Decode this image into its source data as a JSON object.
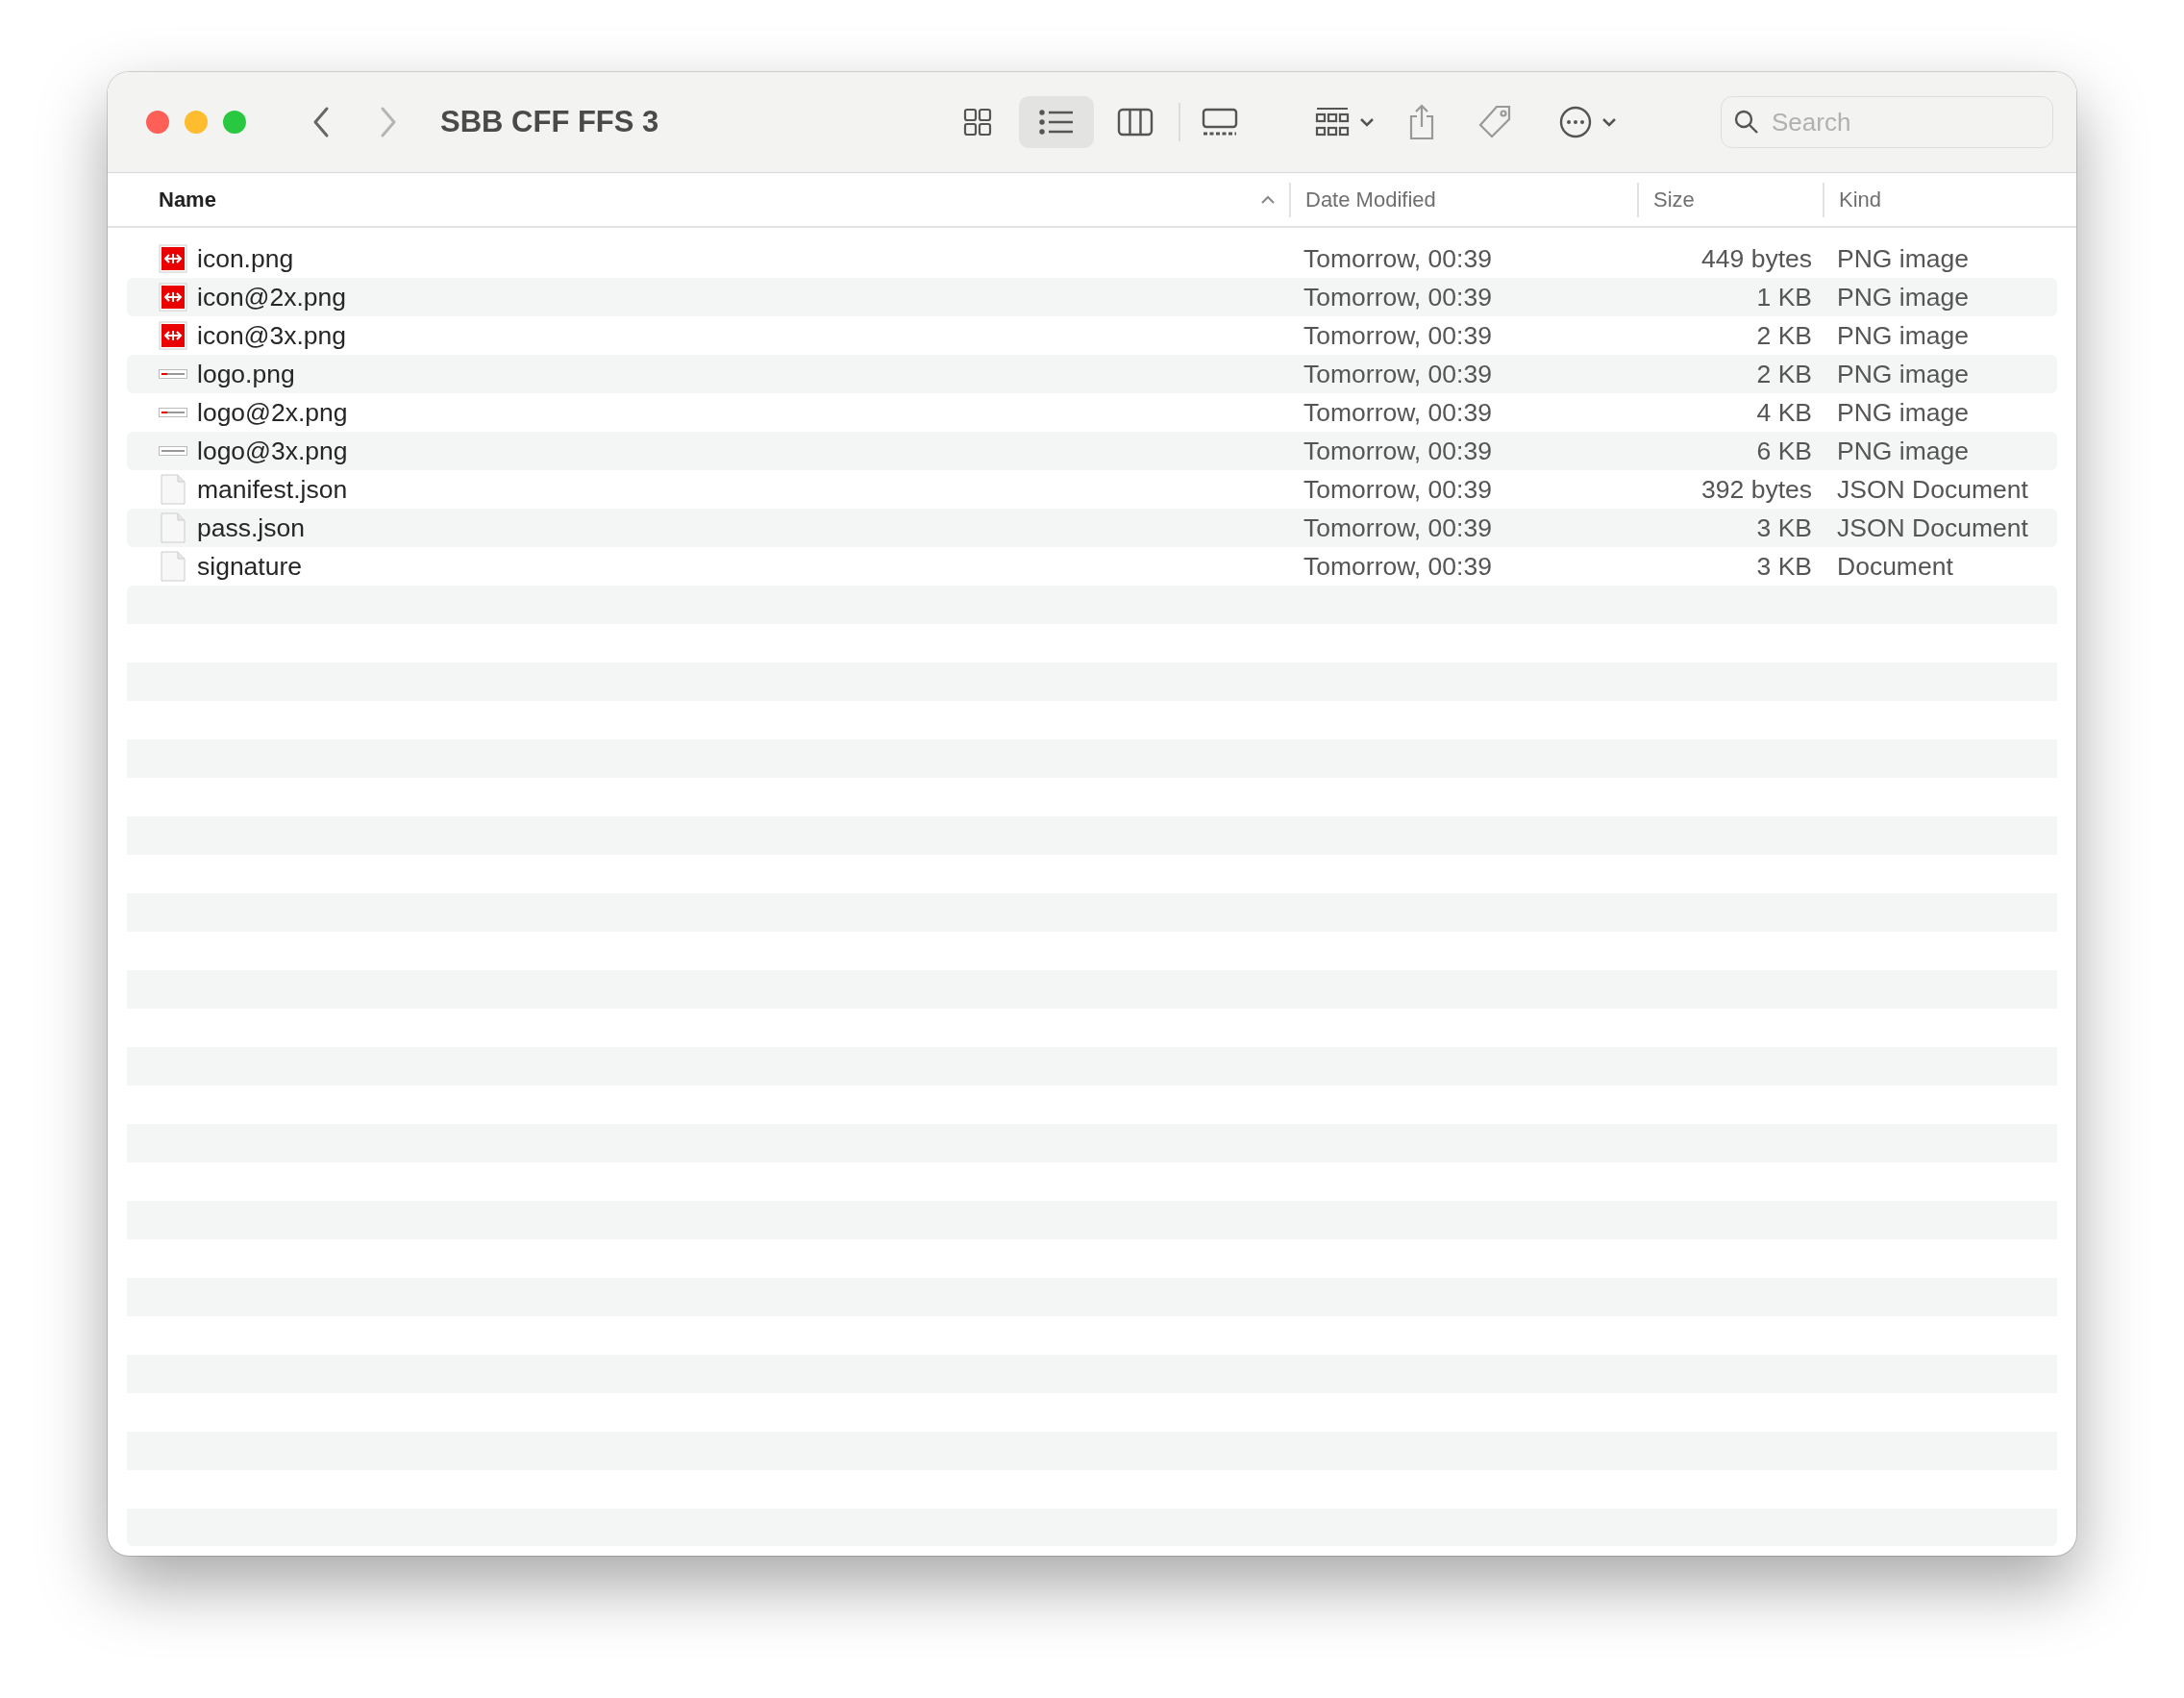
{
  "window": {
    "title": "SBB CFF FFS 3"
  },
  "navigation": {
    "back": {
      "disabled": false
    },
    "forward": {
      "disabled": true
    }
  },
  "view_modes": [
    {
      "kind": "icons",
      "selected": false
    },
    {
      "kind": "list",
      "selected": true
    },
    {
      "kind": "columns",
      "selected": false
    },
    {
      "kind": "gallery",
      "selected": false
    }
  ],
  "search": {
    "placeholder": "Search"
  },
  "table": {
    "columns": [
      {
        "label": "Name",
        "sorted": true
      },
      {
        "label": "Date Modified",
        "sorted": false
      },
      {
        "label": "Size",
        "sorted": false
      },
      {
        "label": "Kind",
        "sorted": false
      }
    ],
    "rows": [
      {
        "kind": "app-icon",
        "name": "icon.png",
        "date": "Tomorrow, 00:39",
        "size": "449 bytes",
        "type": "PNG image"
      },
      {
        "kind": "app-icon",
        "name": "icon@2x.png",
        "date": "Tomorrow, 00:39",
        "size": "1 KB",
        "type": "PNG image"
      },
      {
        "kind": "app-icon",
        "name": "icon@3x.png",
        "date": "Tomorrow, 00:39",
        "size": "2 KB",
        "type": "PNG image"
      },
      {
        "kind": "logo",
        "name": "logo.png",
        "date": "Tomorrow, 00:39",
        "size": "2 KB",
        "type": "PNG image"
      },
      {
        "kind": "logo",
        "name": "logo@2x.png",
        "date": "Tomorrow, 00:39",
        "size": "4 KB",
        "type": "PNG image"
      },
      {
        "kind": "logo-plain",
        "name": "logo@3x.png",
        "date": "Tomorrow, 00:39",
        "size": "6 KB",
        "type": "PNG image"
      },
      {
        "kind": "document",
        "name": "manifest.json",
        "date": "Tomorrow, 00:39",
        "size": "392 bytes",
        "type": "JSON Document"
      },
      {
        "kind": "document",
        "name": "pass.json",
        "date": "Tomorrow, 00:39",
        "size": "3 KB",
        "type": "JSON Document"
      },
      {
        "kind": "document",
        "name": "signature",
        "date": "Tomorrow, 00:39",
        "size": "3 KB",
        "type": "Document"
      }
    ]
  }
}
